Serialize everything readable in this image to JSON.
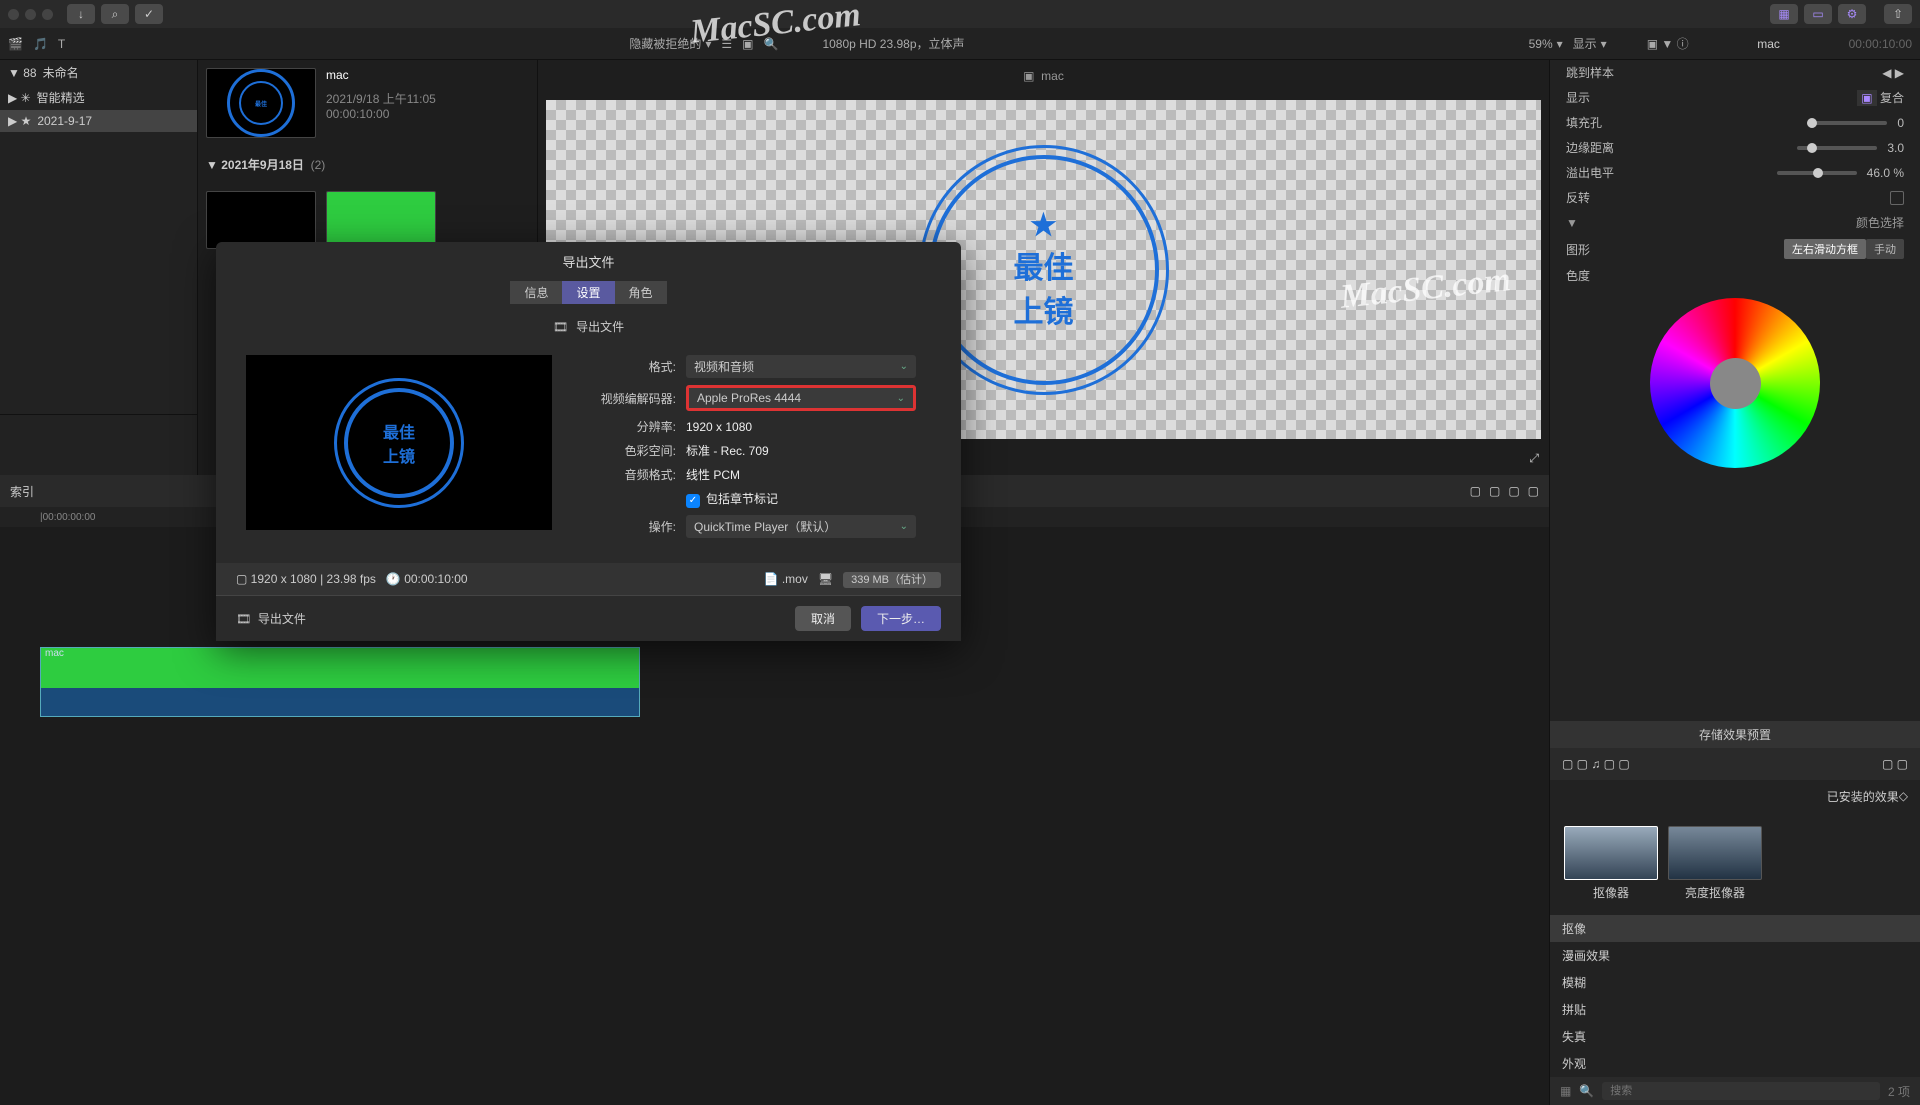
{
  "window": {
    "title": "导出文件"
  },
  "toolbar": {
    "filter": "隐藏被拒绝的",
    "zoom": "59%",
    "view": "显示"
  },
  "viewer": {
    "format": "1080p HD 23.98p，立体声",
    "name": "mac"
  },
  "sidebar": {
    "library": "未命名",
    "smart": "智能精选",
    "event": "2021-9-17"
  },
  "browser": {
    "clipName": "mac",
    "clipDate": "2021/9/18 上午11:05",
    "clipDur": "00:00:10:00",
    "groupDate": "2021年9月18日",
    "groupCount": "(2)"
  },
  "inspector": {
    "name": "mac",
    "time": "00:00:10:00",
    "row0": "跳到样本",
    "row1": {
      "label": "显示",
      "val": "复合"
    },
    "row2": {
      "label": "填充孔",
      "val": "0"
    },
    "row3": {
      "label": "边缘距离",
      "val": "3.0"
    },
    "row4": {
      "label": "溢出电平",
      "val": "46.0 %"
    },
    "row5": "反转",
    "section": "颜色选择",
    "row6": "图形",
    "row7": "色度",
    "seg1": "左右滑动方框",
    "seg2": "手动",
    "savePreset": "存储效果预置"
  },
  "timeline": {
    "index": "索引",
    "tc": "00:00:00:00",
    "clipName": "mac"
  },
  "effects": {
    "title": "已安装的效果",
    "count": "2 项",
    "tile1": "抠像器",
    "tile2": "亮度抠像器",
    "searchPlaceholder": "搜索",
    "cat": [
      "抠像",
      "漫画效果",
      "模糊",
      "拼贴",
      "失真",
      "外观"
    ]
  },
  "dialog": {
    "title": "导出文件",
    "tabs": {
      "info": "信息",
      "settings": "设置",
      "roles": "角色"
    },
    "header": "导出文件",
    "format": {
      "label": "格式:",
      "val": "视频和音频"
    },
    "codec": {
      "label": "视频编解码器:",
      "val": "Apple ProRes 4444"
    },
    "res": {
      "label": "分辨率:",
      "val": "1920 x 1080"
    },
    "cs": {
      "label": "色彩空间:",
      "val": "标准 - Rec. 709"
    },
    "audio": {
      "label": "音频格式:",
      "val": "线性 PCM"
    },
    "chapters": "包括章节标记",
    "action": {
      "label": "操作:",
      "val": "QuickTime Player（默认）"
    },
    "meta": {
      "dim": "1920 x 1080",
      "fps": "23.98 fps",
      "dur": "00:00:10:00",
      "ext": ".mov",
      "size": "339 MB（估计）"
    },
    "footer": {
      "label": "导出文件",
      "cancel": "取消",
      "next": "下一步…"
    }
  },
  "stamp": {
    "l1": "最佳",
    "l2": "上镜"
  },
  "watermark": "MacSC.com"
}
